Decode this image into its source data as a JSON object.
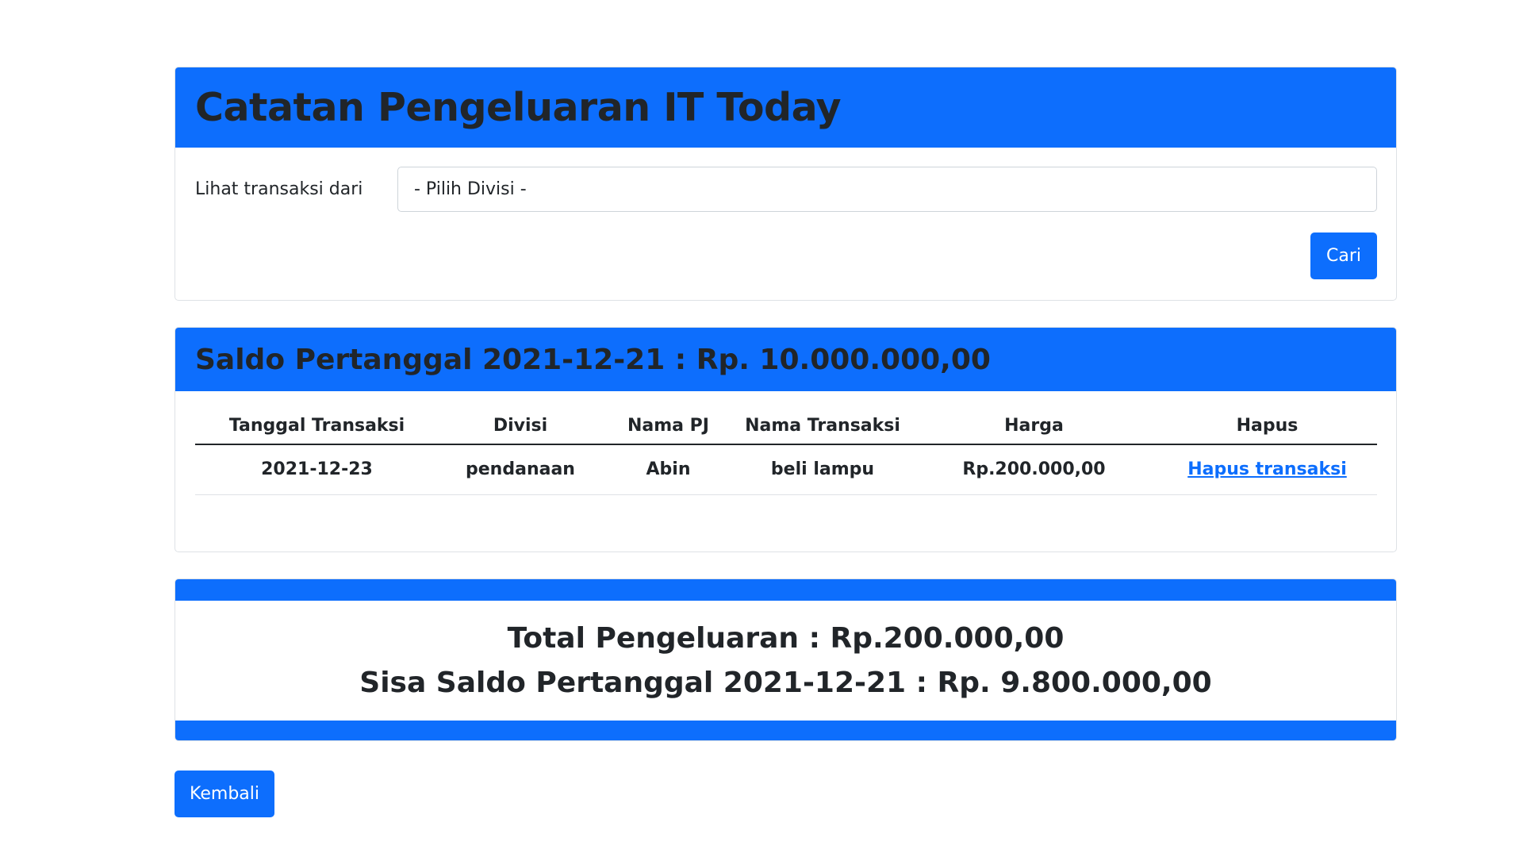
{
  "header": {
    "title": "Catatan Pengeluaran IT Today"
  },
  "filter": {
    "label": "Lihat transaksi dari",
    "select_value": "- Pilih Divisi -",
    "search_button": "Cari"
  },
  "balance": {
    "title": "Saldo Pertanggal 2021-12-21 : Rp. 10.000.000,00"
  },
  "table": {
    "columns": [
      "Tanggal Transaksi",
      "Divisi",
      "Nama PJ",
      "Nama Transaksi",
      "Harga",
      "Hapus"
    ],
    "rows": [
      {
        "date": "2021-12-23",
        "division": "pendanaan",
        "pj": "Abin",
        "transaction": "beli lampu",
        "price": "Rp.200.000,00",
        "delete_label": "Hapus transaksi"
      }
    ]
  },
  "summary": {
    "total": "Total Pengeluaran : Rp.200.000,00",
    "remaining": "Sisa Saldo Pertanggal 2021-12-21 : Rp. 9.800.000,00"
  },
  "footer": {
    "back_button": "Kembali"
  },
  "colors": {
    "primary": "#0d6efd",
    "text": "#212529",
    "border": "#dee2e6"
  }
}
